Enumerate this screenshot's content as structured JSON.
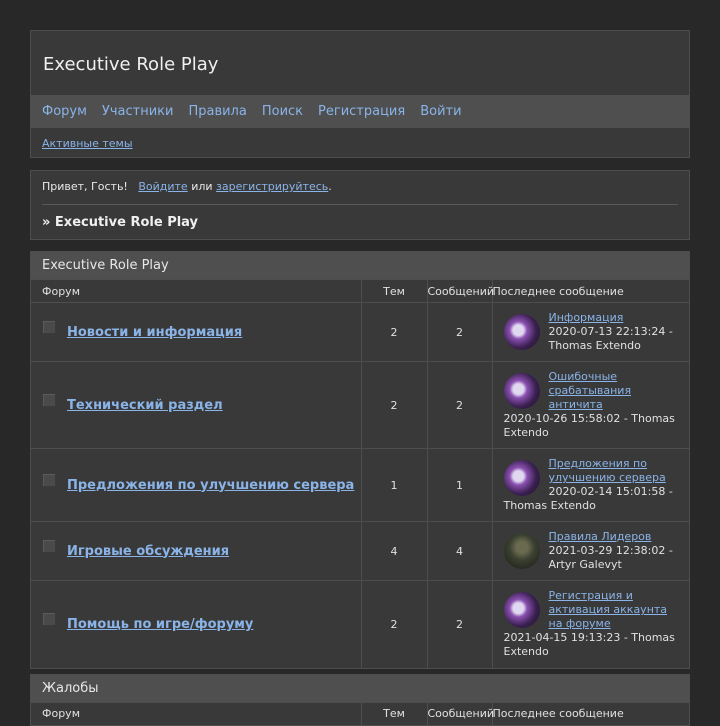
{
  "site": {
    "title": "Executive Role Play"
  },
  "nav": [
    {
      "label": "Форум"
    },
    {
      "label": "Участники"
    },
    {
      "label": "Правила"
    },
    {
      "label": "Поиск"
    },
    {
      "label": "Регистрация"
    },
    {
      "label": "Войти"
    }
  ],
  "sublinks": {
    "active_topics": "Активные темы"
  },
  "welcome": {
    "greeting": "Привет, Гость!",
    "login_link": "Войдите",
    "or": "или",
    "register_link": "зарегистрируйтесь",
    "period": "."
  },
  "breadcrumb": "» Executive Role Play",
  "categories": [
    {
      "title": "Executive Role Play",
      "headers": {
        "forum": "Форум",
        "topics": "Тем",
        "posts": "Сообщений",
        "last": "Последнее сообщение"
      },
      "forums": [
        {
          "name": "Новости и информация",
          "topics": "2",
          "posts": "2",
          "last_title": "Информация",
          "last_meta": "2020-07-13 22:13:24 - Thomas Extendo",
          "avatar": "avatar-purple"
        },
        {
          "name": "Технический раздел",
          "topics": "2",
          "posts": "2",
          "last_title": "Ошибочные срабатывания античита",
          "last_meta": "2020-10-26 15:58:02 - Thomas Extendo",
          "avatar": "avatar-purple"
        },
        {
          "name": "Предложения по улучшению сервера",
          "topics": "1",
          "posts": "1",
          "last_title": "Предложения по улучшению сервера",
          "last_meta": "2020-02-14 15:01:58 - Thomas Extendo",
          "avatar": "avatar-purple"
        },
        {
          "name": "Игровые обсуждения",
          "topics": "4",
          "posts": "4",
          "last_title": "Правила Лидеров",
          "last_meta": "2021-03-29 12:38:02 - Artyr Galevyt",
          "avatar": "avatar-dark"
        },
        {
          "name": "Помощь по игре/форуму",
          "topics": "2",
          "posts": "2",
          "last_title": "Регистрация и активация аккаунта на форуме",
          "last_meta": "2021-04-15 19:13:23 - Thomas Extendo",
          "avatar": "avatar-purple"
        }
      ]
    },
    {
      "title": "Жалобы",
      "headers": {
        "forum": "Форум",
        "topics": "Тем",
        "posts": "Сообщений",
        "last": "Последнее сообщение"
      }
    }
  ]
}
